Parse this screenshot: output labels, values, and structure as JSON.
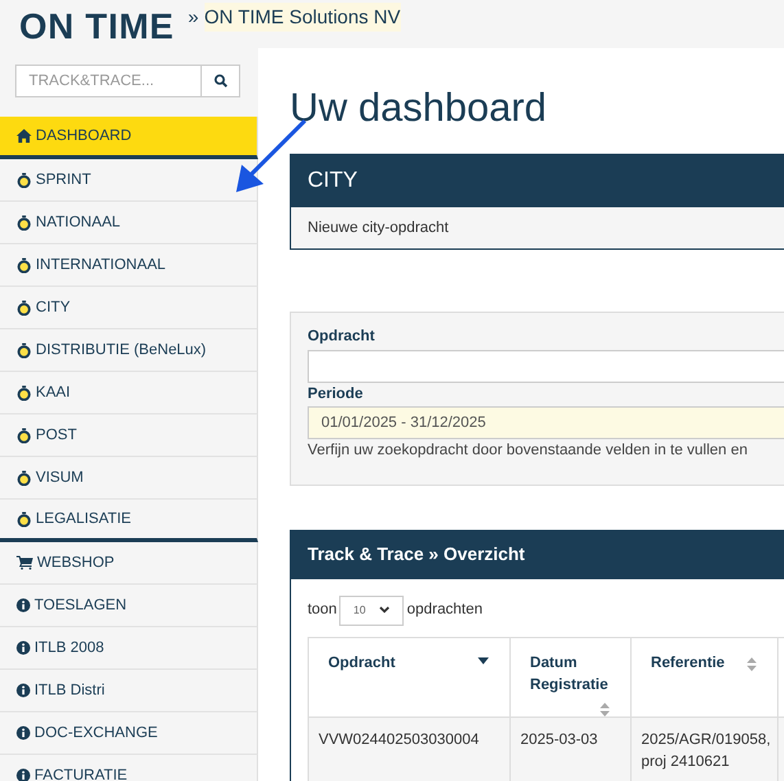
{
  "header": {
    "logo": "ON TIME",
    "breadcrumb_separator": "»",
    "company": "ON TIME Solutions NV"
  },
  "search": {
    "placeholder": "TRACK&TRACE..."
  },
  "sidebar": {
    "items": [
      {
        "label": "DASHBOARD",
        "kind": "home",
        "selected": true
      },
      {
        "label": "SPRINT",
        "kind": "service",
        "selected": false
      },
      {
        "label": "NATIONAAL",
        "kind": "service",
        "selected": false
      },
      {
        "label": "INTERNATIONAAL",
        "kind": "service",
        "selected": false
      },
      {
        "label": "CITY",
        "kind": "service",
        "selected": false
      },
      {
        "label": "DISTRIBUTIE (BeNeLux)",
        "kind": "service",
        "selected": false
      },
      {
        "label": "KAAI",
        "kind": "service",
        "selected": false
      },
      {
        "label": "POST",
        "kind": "service",
        "selected": false
      },
      {
        "label": "VISUM",
        "kind": "service",
        "selected": false
      },
      {
        "label": "LEGALISATIE",
        "kind": "service",
        "selected": false
      },
      {
        "label": "WEBSHOP",
        "kind": "cart",
        "selected": false
      },
      {
        "label": "TOESLAGEN",
        "kind": "info",
        "selected": false
      },
      {
        "label": "ITLB 2008",
        "kind": "info",
        "selected": false
      },
      {
        "label": "ITLB Distri",
        "kind": "info",
        "selected": false
      },
      {
        "label": "DOC-EXCHANGE",
        "kind": "info",
        "selected": false
      },
      {
        "label": "FACTURATIE",
        "kind": "info",
        "selected": false
      }
    ]
  },
  "page_title": "Uw dashboard",
  "city_panel": {
    "title": "CITY",
    "link": "Nieuwe city-opdracht"
  },
  "filter": {
    "fields": [
      {
        "label": "Opdracht",
        "highlight": false
      },
      {
        "label": "Periode",
        "value": "01/01/2025 - 31/12/2025",
        "highlight": true
      }
    ],
    "hint": "Verfijn uw zoekopdracht door bovenstaande velden in te vullen en"
  },
  "track_panel": {
    "title": "Track & Trace » Overzicht",
    "show_prefix": "toon",
    "page_size": "10",
    "show_suffix": "opdrachten",
    "table": {
      "columns": [
        {
          "label": "Opdracht",
          "kind": "desc"
        },
        {
          "label": "Datum Registratie",
          "kind": "both"
        },
        {
          "label": "Referentie",
          "kind": "both"
        }
      ],
      "rows": [
        [
          "VVW024402503030004",
          "2025-03-03",
          "2025/AGR/019058, proj 2410621"
        ]
      ]
    }
  }
}
